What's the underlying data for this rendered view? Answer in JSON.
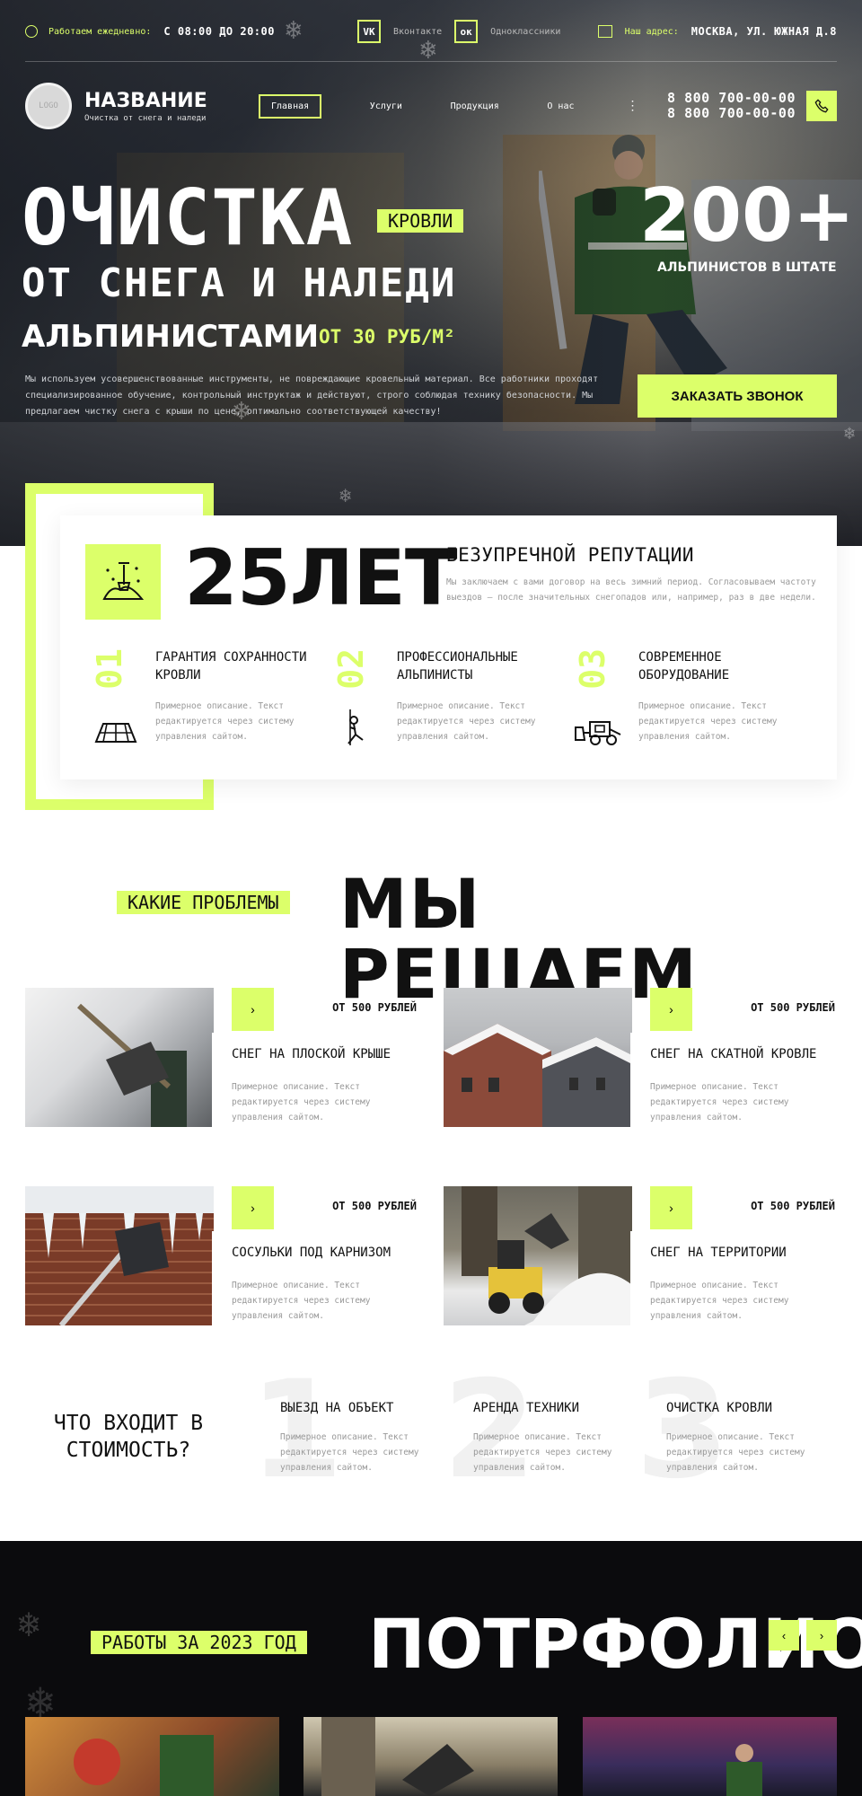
{
  "topbar": {
    "hours_label": "Работаем ежедневно:",
    "hours_value": "С 08:00 ДО 20:00",
    "vk_label": "Вконтакте",
    "ok_label": "Одноклассники",
    "address_label": "Наш адрес:",
    "address_value": "МОСКВА, УЛ. ЮЖНАЯ Д.8"
  },
  "header": {
    "logo_text": "LOGO",
    "brand_name": "НАЗВАНИЕ",
    "brand_tagline": "Очистка от снега и наледи",
    "nav": [
      "Главная",
      "Услуги",
      "Продукция",
      "О нас"
    ],
    "phone_1": "8 800 700-00-00",
    "phone_2": "8 800 700-00-00"
  },
  "hero": {
    "title_1": "ОЧИСТКА",
    "title_tag": "КРОВЛИ",
    "title_2": "ОТ СНЕГА И НАЛЕДИ",
    "title_3": "АЛЬПИНИСТАМИ",
    "price": "ОТ 30 РУБ/М²",
    "description": "Мы используем усовершенствованные инструменты, не повреждающие кровельный материал. Все работники проходят специализированное обучение, контрольный инструктаж и действуют, строго соблюдая технику безопасности. Мы предлагаем чистку снега с крыши по цене, оптимально соответствующей качеству!",
    "stat_value": "200+",
    "stat_label": "АЛЬПИНИСТОВ В ШТАТЕ",
    "cta": "ЗАКАЗАТЬ ЗВОНОК"
  },
  "about": {
    "years": "25ЛЕТ",
    "reputation_title": "БЕЗУПРЕЧНОЙ РЕПУТАЦИИ",
    "reputation_desc": "Мы заключаем с вами договор на весь зимний период. Согласовываем частоту выездов — после значительных снегопадов или, например, раз в две недели.",
    "features": [
      {
        "num": "01",
        "title": "ГАРАНТИЯ СОХРАННОСТИ КРОВЛИ",
        "desc": "Примерное описание. Текст редактируется через систему управления сайтом.",
        "icon": "roof-tiles-icon"
      },
      {
        "num": "02",
        "title": "ПРОФЕССИОНАЛЬНЫЕ АЛЬПИНИСТЫ",
        "desc": "Примерное описание. Текст редактируется через систему управления сайтом.",
        "icon": "climber-icon"
      },
      {
        "num": "03",
        "title": "СОВРЕМЕННОЕ ОБОРУДОВАНИЕ",
        "desc": "Примерное описание. Текст редактируется через систему управления сайтом.",
        "icon": "snow-plow-icon"
      }
    ]
  },
  "problems": {
    "tag": "КАКИЕ ПРОБЛЕМЫ",
    "title": "МЫ РЕШАЕМ",
    "items": [
      {
        "price": "ОТ 500 РУБЛЕЙ",
        "title": "СНЕГ НА ПЛОСКОЙ КРЫШЕ",
        "desc": "Примерное описание. Текст редактируется через систему управления сайтом."
      },
      {
        "price": "ОТ 500 РУБЛЕЙ",
        "title": "СНЕГ НА СКАТНОЙ КРОВЛЕ",
        "desc": "Примерное описание. Текст редактируется через систему управления сайтом."
      },
      {
        "price": "ОТ 500 РУБЛЕЙ",
        "title": "СОСУЛЬКИ ПОД КАРНИЗОМ",
        "desc": "Примерное описание. Текст редактируется через систему управления сайтом."
      },
      {
        "price": "ОТ 500 РУБЛЕЙ",
        "title": "СНЕГ НА ТЕРРИТОРИИ",
        "desc": "Примерное описание. Текст редактируется через систему управления сайтом."
      }
    ]
  },
  "included": {
    "question": "ЧТО ВХОДИТ В СТОИМОСТЬ?",
    "steps": [
      {
        "num": "1",
        "title": "ВЫЕЗД НА ОБЪЕКТ",
        "desc": "Примерное описание. Текст редактируется через систему управления сайтом."
      },
      {
        "num": "2",
        "title": "АРЕНДА ТЕХНИКИ",
        "desc": "Примерное описание. Текст редактируется через систему управления сайтом."
      },
      {
        "num": "3",
        "title": "ОЧИСТКА КРОВЛИ",
        "desc": "Примерное описание. Текст редактируется через систему управления сайтом."
      }
    ]
  },
  "portfolio": {
    "tag": "РАБОТЫ ЗА 2023 ГОД",
    "title": "ПОТРФОЛИО"
  },
  "colors": {
    "accent": "#dcff6a",
    "dark": "#0b0b0d",
    "muted_text": "#999999"
  }
}
